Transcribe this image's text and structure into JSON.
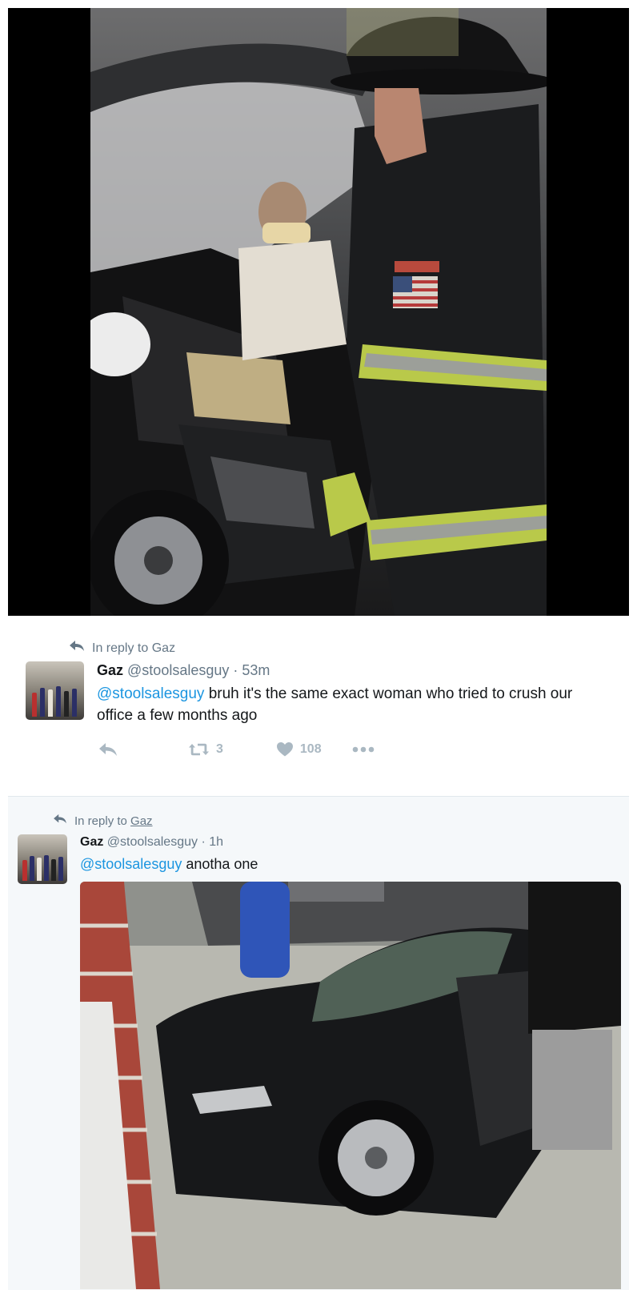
{
  "tweet1": {
    "media_alt": "firefighter-beside-crashed-car-photo",
    "reply_context_prefix": "In reply to",
    "reply_context_user": "Gaz",
    "author_name": "Gaz",
    "author_handle": "@stoolsalesguy",
    "separator": "·",
    "timestamp": "53m",
    "mention": "@stoolsalesguy",
    "text": " bruh it's the same exact woman who tried to crush our office a few months ago",
    "retweet_count": "3",
    "like_count": "108"
  },
  "tweet2": {
    "reply_context_prefix": "In reply to",
    "reply_context_user": "Gaz",
    "author_name": "Gaz",
    "author_handle": "@stoolsalesguy",
    "separator": "·",
    "timestamp": "1h",
    "mention": "@stoolsalesguy",
    "text": " anotha one",
    "media_alt": "black-car-crashed-into-brick-building-photo"
  },
  "colors": {
    "link": "#1b95e0",
    "muted": "#657786",
    "action_gray": "#aab8c2",
    "highlight_bg": "#f5f8fa"
  },
  "icons": [
    "reply-arrow-icon",
    "reply-icon",
    "retweet-icon",
    "heart-icon",
    "more-dots-icon"
  ]
}
